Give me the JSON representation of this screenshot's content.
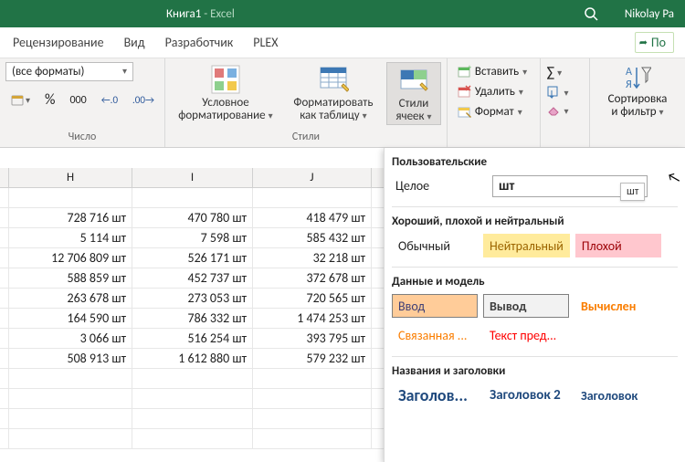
{
  "header": {
    "title_doc": "Книга1",
    "title_sep": "  -  ",
    "title_app": "Excel",
    "user": "Nikolay Pa"
  },
  "tabs": {
    "t1": "Рецензирование",
    "t2": "Вид",
    "t3": "Разработчик",
    "t4": "PLEX",
    "share": "По"
  },
  "ribbon": {
    "format_select": "(все форматы)",
    "numgroup": "Число",
    "stylesgroup": "Стили",
    "cond_fmt": "Условное\nформатирование",
    "fmt_table": "Форматировать\nкак таблицу",
    "cell_styles": "Стили\nячеек",
    "insert": "Вставить",
    "delete": "Удалить",
    "format": "Формат",
    "sort": "Сортировка\nи фильтр"
  },
  "grid": {
    "col_h": "H",
    "col_i": "I",
    "col_j": "J",
    "rows": [
      {
        "h": "728 716 шт",
        "i": "470 780 шт",
        "j": "418 479 шт"
      },
      {
        "h": "5 114 шт",
        "i": "7 598 шт",
        "j": "585 432 шт"
      },
      {
        "h": "12 706 809 шт",
        "i": "526 171 шт",
        "j": "32 218 шт"
      },
      {
        "h": "588 859 шт",
        "i": "452 737 шт",
        "j": "372 678 шт"
      },
      {
        "h": "263 678 шт",
        "i": "273 053 шт",
        "j": "720 565 шт"
      },
      {
        "h": "164 590 шт",
        "i": "786 332 шт",
        "j": "1 474 253 шт"
      },
      {
        "h": "3 066 шт",
        "i": "516 254 шт",
        "j": "393 795 шт"
      },
      {
        "h": "508 913 шт",
        "i": "1 612 880 шт",
        "j": "579 232 шт"
      }
    ]
  },
  "panel": {
    "sec_user": "Пользовательские",
    "whole": "Целое",
    "input_val": "шт",
    "tooltip": "шт",
    "sec_good": "Хороший, плохой и нейтральный",
    "normal": "Обычный",
    "neutral": "Нейтральный",
    "bad": "Плохой",
    "sec_data": "Данные и модель",
    "input": "Ввод",
    "output": "Вывод",
    "calc": "Вычислен",
    "linked": "Связанная ...",
    "warn": "Текст пред...",
    "sec_head": "Названия и заголовки",
    "h1": "Заголов...",
    "h2": "Заголовок 2",
    "h3": "Заголовок"
  },
  "num_sym": {
    "pct": "%",
    "sep": "000",
    "dec_inc": ".0",
    "dec_dec": ".00",
    "cur": "₽"
  }
}
